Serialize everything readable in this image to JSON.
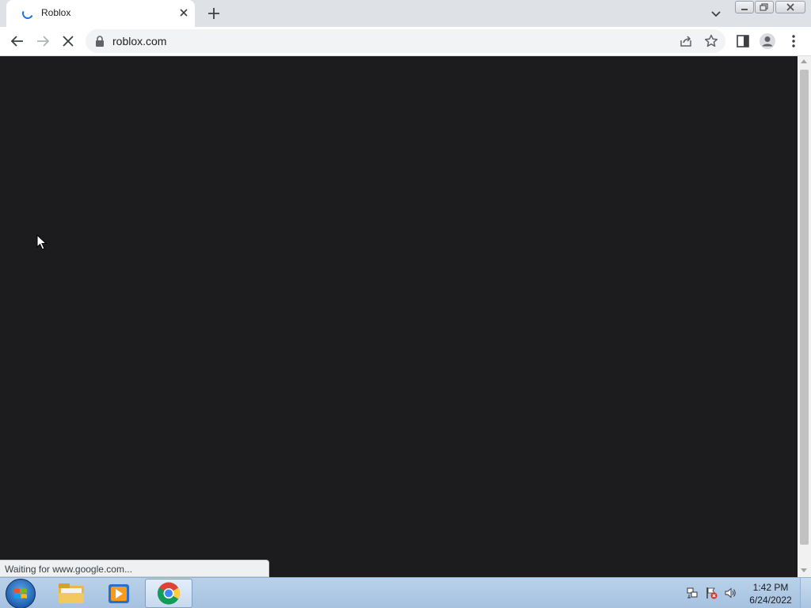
{
  "tab": {
    "title": "Roblox"
  },
  "toolbar": {
    "url": "roblox.com"
  },
  "status": {
    "text": "Waiting for www.google.com..."
  },
  "taskbar": {
    "apps": [
      "windows-explorer",
      "media-player",
      "google-chrome"
    ],
    "clock": {
      "time": "1:42 PM",
      "date": "6/24/2022"
    }
  },
  "colors": {
    "page_background": "#1c1c1e",
    "accent": "#1a73e8"
  }
}
